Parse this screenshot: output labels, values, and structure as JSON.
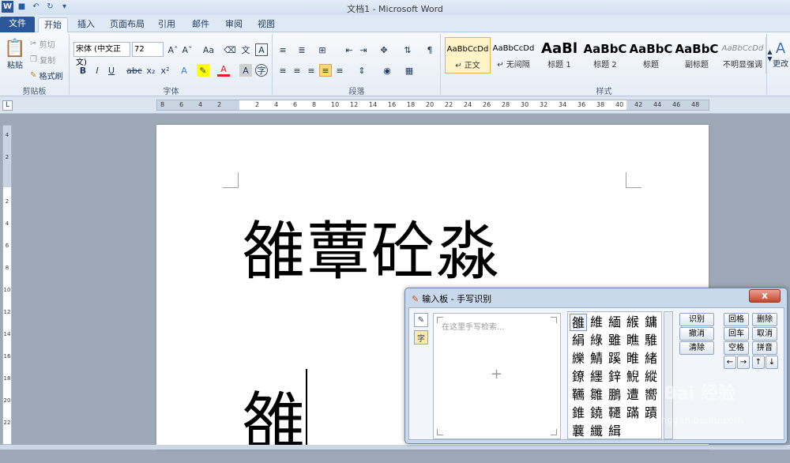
{
  "window": {
    "title": "文档1 - Microsoft Word"
  },
  "ribbon_tabs": [
    "文件",
    "开始",
    "插入",
    "页面布局",
    "引用",
    "邮件",
    "审阅",
    "视图"
  ],
  "clipboard": {
    "paste": "粘贴",
    "cut": "剪切",
    "copy": "复制",
    "format_painter": "格式刷",
    "label": "剪贴板"
  },
  "font": {
    "name": "宋体 (中文正文)",
    "size": "72",
    "label": "字体",
    "bold": "B",
    "italic": "I",
    "underline": "U",
    "strike": "abc",
    "sub": "x₂",
    "sup": "x²"
  },
  "paragraph": {
    "label": "段落"
  },
  "styles": {
    "label": "样式",
    "more_label": "更改",
    "items": [
      {
        "sample": "AaBbCcDd",
        "name": "↵ 正文"
      },
      {
        "sample": "AaBbCcDd",
        "name": "↵ 无间隔"
      },
      {
        "sample": "AaBl",
        "name": "标题 1"
      },
      {
        "sample": "AaBbC",
        "name": "标题 2"
      },
      {
        "sample": "AaBbC",
        "name": "标题"
      },
      {
        "sample": "AaBbC",
        "name": "副标题"
      },
      {
        "sample": "AaBbCcDd",
        "name": "不明显强调"
      }
    ]
  },
  "ruler": {
    "h_ticks": [
      "8",
      "6",
      "4",
      "2",
      "",
      "2",
      "4",
      "6",
      "8",
      "10",
      "12",
      "14",
      "16",
      "18",
      "20",
      "22",
      "24",
      "26",
      "28",
      "30",
      "32",
      "34",
      "36",
      "38",
      "40",
      "42",
      "44",
      "46",
      "48"
    ],
    "v_ticks": [
      "4",
      "2",
      "",
      "2",
      "4",
      "6",
      "8",
      "10",
      "12",
      "14",
      "16",
      "18",
      "20",
      "22"
    ],
    "corner": "L"
  },
  "document": {
    "line1": "雒蕈砼淼",
    "line2": "雒"
  },
  "ime": {
    "title": "输入板 - 手写识别",
    "close": "x",
    "placeholder": "在这里手写检索...",
    "plus": "+",
    "candidates": [
      [
        "雒",
        "維",
        "緬",
        "緱",
        "鏞"
      ],
      [
        "絹",
        "綠",
        "雖",
        "瞧",
        "騅"
      ],
      [
        "纅",
        "鯖",
        "蹊",
        "睢",
        "緒"
      ],
      [
        "鐐",
        "纆",
        "鋅",
        "鯢",
        "縱"
      ],
      [
        "韉",
        "雛",
        "鵬",
        "遭",
        "嚮"
      ],
      [
        "錐",
        "鐃",
        "韆",
        "蹣",
        "蹟"
      ],
      [
        "蘘",
        "纖",
        "緝",
        "",
        ""
      ]
    ],
    "actions": [
      "识别",
      "撤消",
      "清除"
    ],
    "keys": [
      "回格",
      "删除",
      "回车",
      "取消",
      "空格",
      "拼音"
    ],
    "arrows": [
      "←",
      "→",
      "↑",
      "↓"
    ]
  },
  "watermark": {
    "text": "Bai 经验",
    "sub": "jingyan.baidu.com"
  }
}
